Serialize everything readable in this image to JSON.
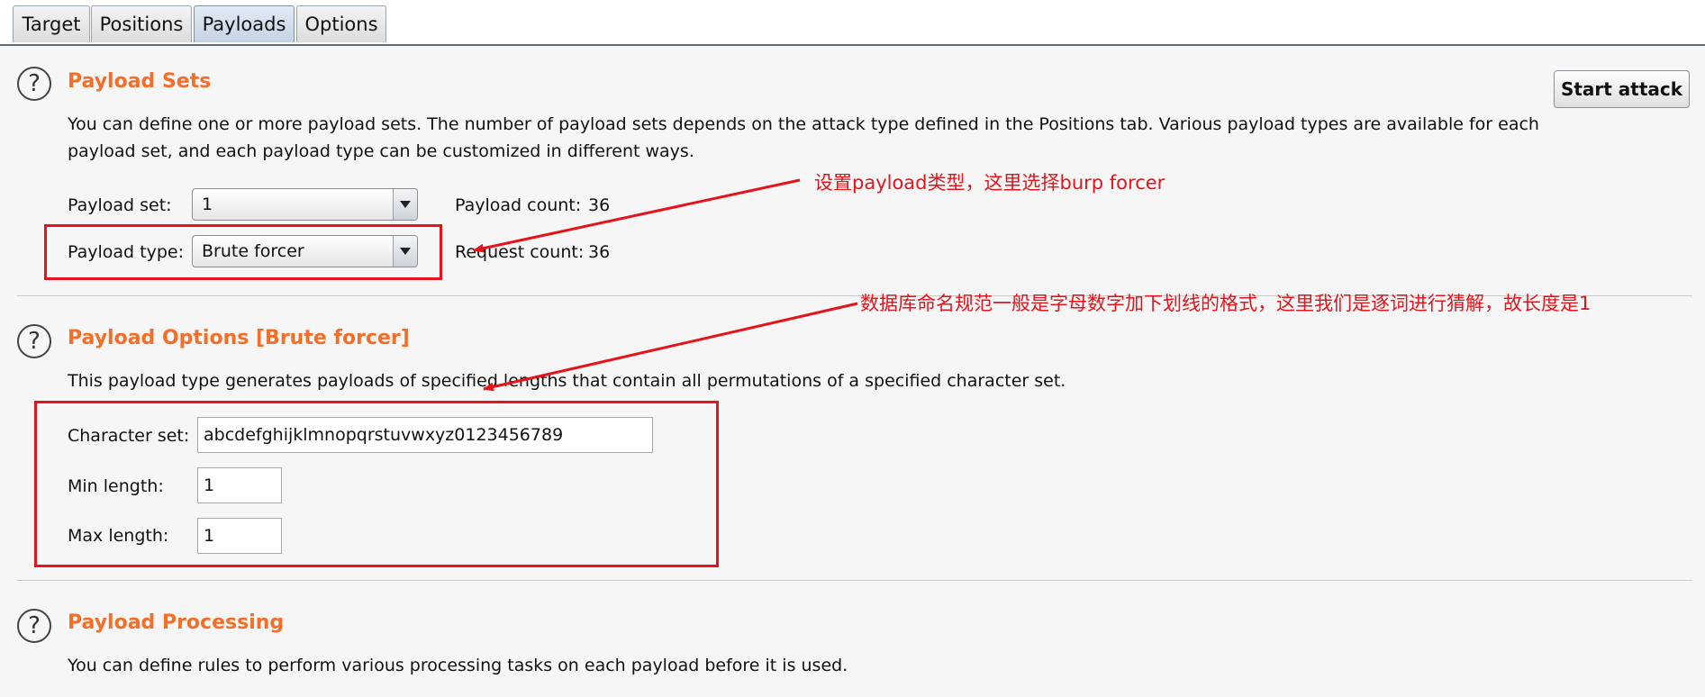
{
  "tabs": [
    {
      "label": "Target"
    },
    {
      "label": "Positions"
    },
    {
      "label": "Payloads"
    },
    {
      "label": "Options"
    }
  ],
  "payload_sets": {
    "title": "Payload Sets",
    "description_line1": "You can define one or more payload sets. The number of payload sets depends on the attack type defined in the Positions tab. Various payload types are available for each",
    "description_line2": "payload set, and each payload type can be customized in different ways.",
    "payload_set_label": "Payload set:",
    "payload_set_value": "1",
    "payload_count_label": "Payload count:",
    "payload_count": "36",
    "payload_type_label": "Payload type:",
    "payload_type_value": "Brute forcer",
    "request_count_label": "Request count:",
    "request_count": "36"
  },
  "start_attack_label": "Start attack",
  "payload_options": {
    "title": "Payload Options [Brute forcer]",
    "description": "This payload type generates payloads of specified lengths that contain all permutations of a specified character set.",
    "character_set_label": "Character set:",
    "character_set_value": "abcdefghijklmnopqrstuvwxyz0123456789",
    "min_length_label": "Min length:",
    "min_length_value": "1",
    "max_length_label": "Max length:",
    "max_length_value": "1"
  },
  "payload_processing": {
    "title": "Payload Processing",
    "description": "You can define rules to perform various processing tasks on each payload before it is used."
  },
  "annotations": {
    "payload_type_note": "设置payload类型，这里选择burp forcer",
    "options_note": "数据库命名规范一般是字母数字加下划线的格式，这里我们是逐词进行猜解，故长度是1"
  },
  "colors": {
    "section_title": "#f26f2a",
    "annotation": "#e3141b"
  }
}
